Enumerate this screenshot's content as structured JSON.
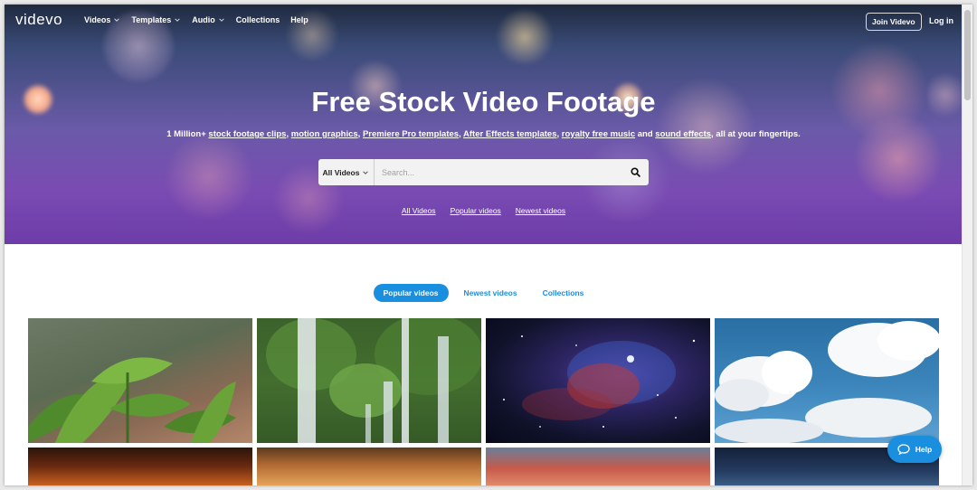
{
  "nav": {
    "logo": "videvo",
    "items": [
      {
        "label": "Videos",
        "dropdown": true
      },
      {
        "label": "Templates",
        "dropdown": true
      },
      {
        "label": "Audio",
        "dropdown": true
      },
      {
        "label": "Collections",
        "dropdown": false
      },
      {
        "label": "Help",
        "dropdown": false
      }
    ],
    "join_label": "Join Videvo",
    "login_label": "Log in"
  },
  "hero": {
    "title": "Free Stock Video Footage",
    "subtitle": {
      "prefix": "1 Million+ ",
      "link1": "stock footage clips",
      "sep1": ", ",
      "link2": "motion graphics",
      "sep2": ", ",
      "link3": "Premiere Pro templates",
      "sep3": ", ",
      "link4": "After Effects templates",
      "sep4": ", ",
      "link5": "royalty free music",
      "sep5": " and ",
      "link6": "sound effects",
      "suffix": ", all at your fingertips."
    },
    "search": {
      "type_selected": "All Videos",
      "placeholder": "Search...",
      "icon": "search-icon"
    },
    "quick_links": [
      "All Videos",
      "Popular videos",
      "Newest videos"
    ]
  },
  "tabs": {
    "items": [
      {
        "label": "Popular videos",
        "active": true
      },
      {
        "label": "Newest videos",
        "active": false
      },
      {
        "label": "Collections",
        "active": false
      }
    ]
  },
  "help_widget": {
    "label": "Help",
    "icon": "chat-bubble-icon"
  },
  "colors": {
    "accent": "#1a8fe0",
    "hero_purple": "#6d3ca8"
  }
}
